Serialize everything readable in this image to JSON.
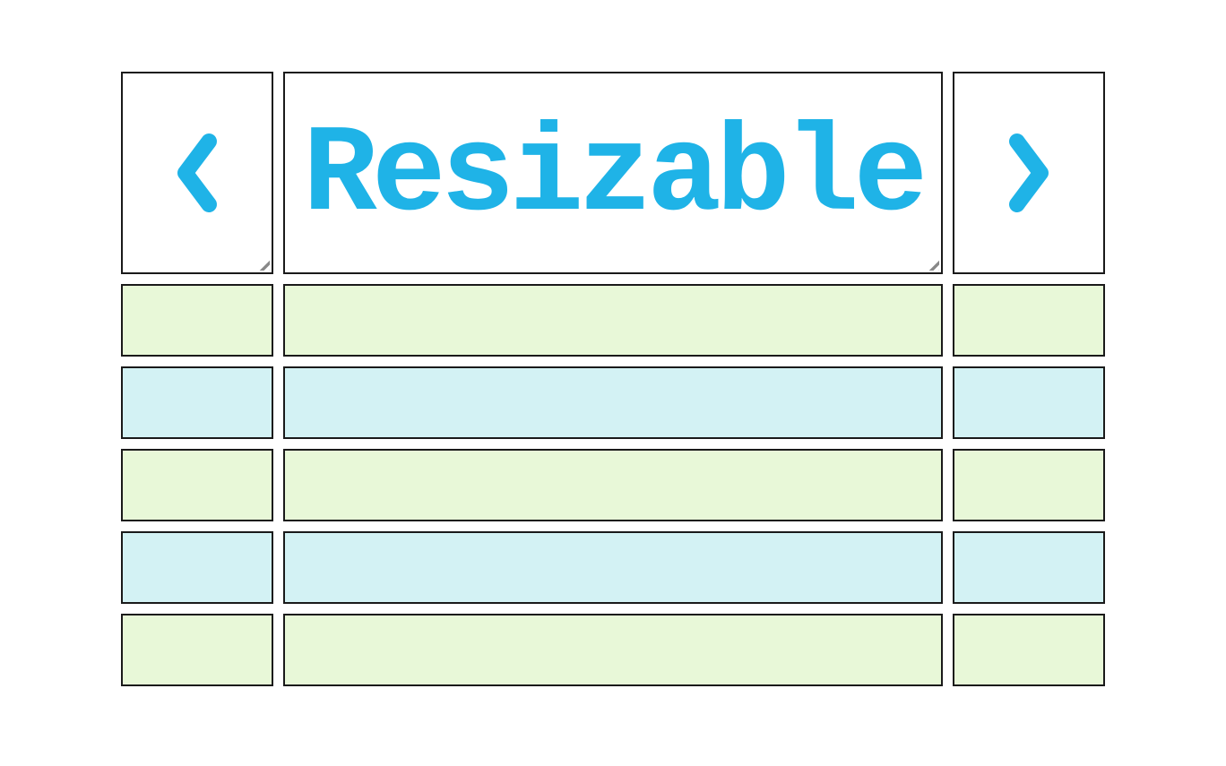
{
  "header": {
    "left_icon": "chevron-left-icon",
    "title": "Resizable",
    "right_icon": "chevron-right-icon"
  },
  "colors": {
    "accent": "#1fb3e7",
    "row_green": "#e8f8d8",
    "row_blue": "#d3f2f4",
    "border": "#1a1a1a"
  },
  "rows": [
    {
      "style": "green",
      "cells": [
        "",
        "",
        ""
      ]
    },
    {
      "style": "blue",
      "cells": [
        "",
        "",
        ""
      ]
    },
    {
      "style": "green",
      "cells": [
        "",
        "",
        ""
      ]
    },
    {
      "style": "blue",
      "cells": [
        "",
        "",
        ""
      ]
    },
    {
      "style": "green",
      "cells": [
        "",
        "",
        ""
      ]
    }
  ]
}
